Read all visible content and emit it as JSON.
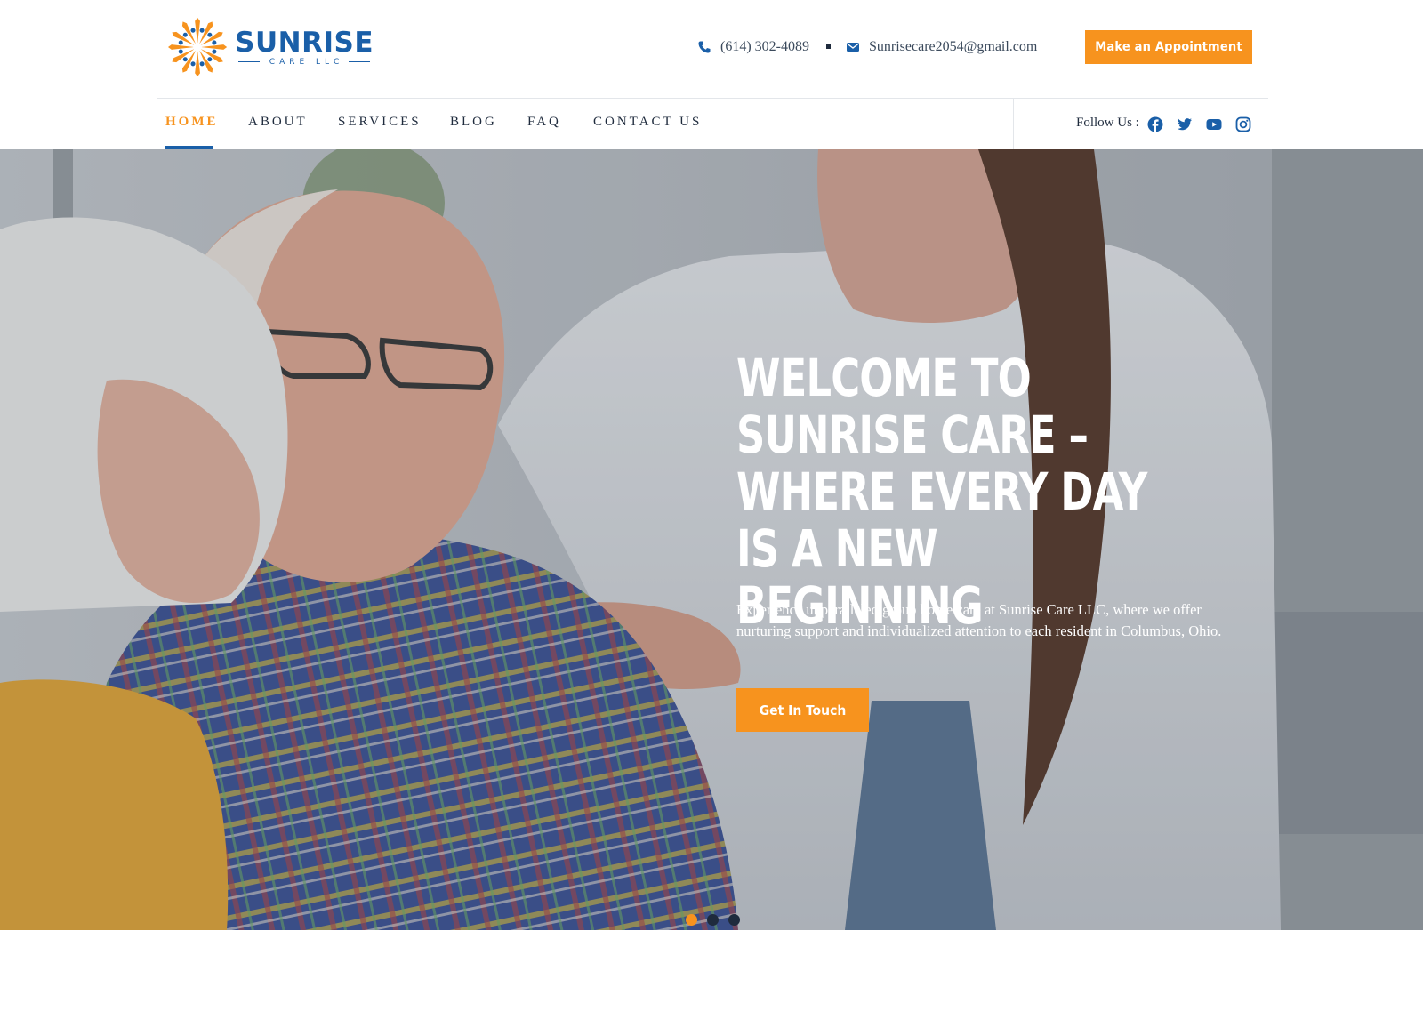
{
  "brand": {
    "name": "SUNRISE",
    "subtitle": "CARE LLC",
    "logo_icon": "sunburst-logo",
    "primary_color": "#1a5fa8",
    "accent_color": "#f7931e"
  },
  "header": {
    "phone": "(614) 302-4089",
    "phone_icon": "phone-icon",
    "email": "Sunrisecare2054@gmail.com",
    "email_icon": "envelope-icon",
    "appointment_label": "Make an Appointment"
  },
  "nav": {
    "items": [
      {
        "label": "HOME",
        "active": true
      },
      {
        "label": "ABOUT",
        "active": false
      },
      {
        "label": "SERVICES",
        "active": false
      },
      {
        "label": "BLOG",
        "active": false
      },
      {
        "label": "FAQ",
        "active": false
      },
      {
        "label": "CONTACT US",
        "active": false
      }
    ],
    "follow_label": "Follow Us :",
    "social": [
      "facebook-icon",
      "twitter-icon",
      "youtube-icon",
      "instagram-icon"
    ]
  },
  "hero": {
    "title": "WELCOME TO SUNRISE CARE – WHERE EVERY DAY IS A NEW BEGINNING",
    "text": "Experience unparalleled group home care at Sunrise Care LLC, where we offer nurturing support and individualized attention to each resident in Columbus, Ohio.",
    "button_label": "Get In Touch",
    "slides": 3,
    "active_slide": 1
  }
}
